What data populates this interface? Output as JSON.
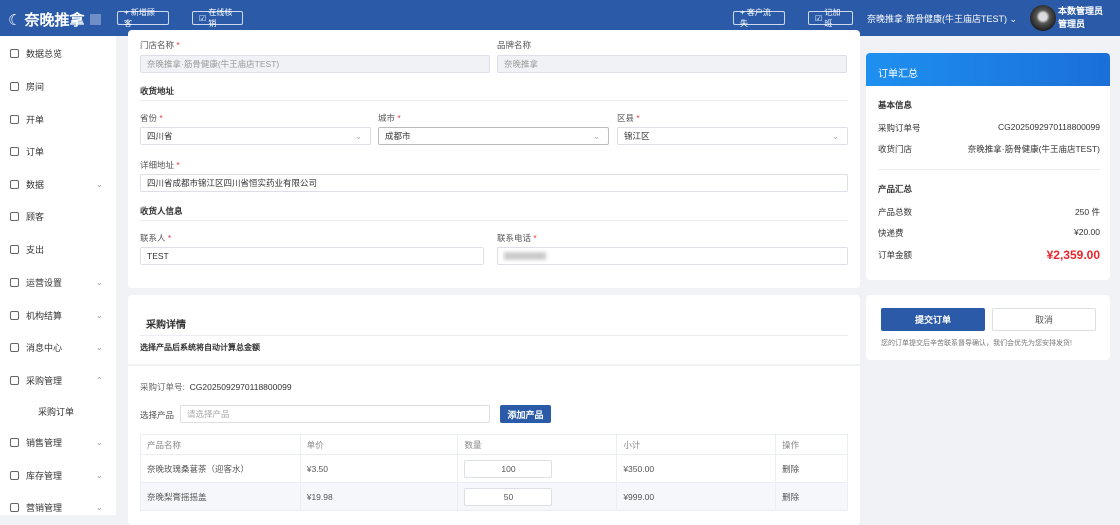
{
  "header": {
    "logo": "奈晚推拿",
    "new_customer": "+ 新增顾客",
    "online_verify": "在线核销",
    "customer_loss": "+ 客户流失",
    "overtime": "记加班",
    "store_select": "奈晚推拿·筋骨健康(牛王庙店TEST)",
    "user_name": "本数管理员",
    "user_role": "管理员"
  },
  "sidebar": {
    "items": [
      {
        "label": "数据总览",
        "icon": "monitor-icon",
        "expand": false
      },
      {
        "label": "房间",
        "icon": "home-icon",
        "expand": false
      },
      {
        "label": "开单",
        "icon": "document-icon",
        "expand": false
      },
      {
        "label": "订单",
        "icon": "order-icon",
        "expand": false
      },
      {
        "label": "数据",
        "icon": "chart-icon",
        "expand": true
      },
      {
        "label": "顾客",
        "icon": "user-icon",
        "expand": false
      },
      {
        "label": "支出",
        "icon": "wallet-icon",
        "expand": false
      },
      {
        "label": "运营设置",
        "icon": "settings-icon",
        "expand": true
      },
      {
        "label": "机构结算",
        "icon": "settlement-icon",
        "expand": true
      },
      {
        "label": "消息中心",
        "icon": "message-icon",
        "expand": true
      },
      {
        "label": "采购管理",
        "icon": "cart-icon",
        "expand": true,
        "open": true
      },
      {
        "label": "销售管理",
        "icon": "sales-icon",
        "expand": true
      },
      {
        "label": "库存管理",
        "icon": "inventory-icon",
        "expand": true
      },
      {
        "label": "营销管理",
        "icon": "marketing-icon",
        "expand": true
      }
    ],
    "sub_item": "采购订单"
  },
  "form": {
    "store_name_label": "门店名称",
    "store_name": "奈晚推拿·筋骨健康(牛王庙店TEST)",
    "brand_label": "品牌名称",
    "brand": "奈晚推拿",
    "address_section": "收货地址",
    "province_label": "省份",
    "province": "四川省",
    "city_label": "城市",
    "city": "成都市",
    "district_label": "区县",
    "district": "锦江区",
    "detail_label": "详细地址",
    "detail": "四川省成都市锦江区四川省恒实药业有限公司",
    "receiver_section": "收货人信息",
    "contact_label": "联系人",
    "contact": "TEST",
    "phone_label": "联系电话"
  },
  "purchase": {
    "title": "采购详情",
    "hint": "选择产品后系统将自动计算总金额",
    "order_no_label": "采购订单号:",
    "order_no": "CG2025092970118800099",
    "select_label": "选择产品",
    "select_placeholder": "请选择产品",
    "add_button": "添加产品",
    "columns": [
      "产品名称",
      "单价",
      "数量",
      "小计",
      "操作"
    ],
    "rows": [
      {
        "name": "奈晚玫瑰桑葚茶（迎客水）",
        "price": "¥3.50",
        "qty": "100",
        "subtotal": "¥350.00",
        "action": "删除"
      },
      {
        "name": "奈晚梨膏摇摇盖",
        "price": "¥19.98",
        "qty": "50",
        "subtotal": "¥999.00",
        "action": "删除"
      }
    ]
  },
  "summary": {
    "title": "订单汇总",
    "basic": "基本信息",
    "order_no_label": "采购订单号",
    "order_no": "CG2025092970118800099",
    "store_label": "收货门店",
    "store": "奈晚推拿·筋骨健康(牛王庙店TEST)",
    "product_section": "产品汇总",
    "total_count_label": "产品总数",
    "total_count": "250 件",
    "shipping_label": "快递费",
    "shipping": "¥20.00",
    "amount_label": "订单金额",
    "amount": "¥2,359.00",
    "submit": "提交订单",
    "cancel": "取消",
    "note": "您的订单提交后辛苦联系督导确认，我们会优先为您安排发货!"
  },
  "colors": {
    "primary": "#2b5ba8",
    "danger": "#e8262c"
  }
}
